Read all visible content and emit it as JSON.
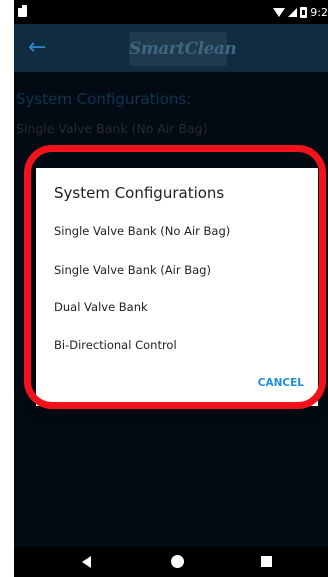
{
  "status_bar": {
    "time": "9:2"
  },
  "app_bar": {
    "logo_text": "SmartClean",
    "back_icon": "arrow-left-icon"
  },
  "screen": {
    "config_title": "System Configurations:",
    "config_value": "Single Valve Bank (No Air Bag)"
  },
  "dialog": {
    "title": "System Configurations",
    "options": [
      "Single Valve Bank (No Air Bag)",
      "Single Valve Bank (Air Bag)",
      "Dual Valve Bank",
      "Bi-Directional Control"
    ],
    "cancel_label": "CANCEL"
  },
  "colors": {
    "accent": "#1e8fe0",
    "highlight": "#f2121b",
    "app_bar": "#0f2c40"
  }
}
